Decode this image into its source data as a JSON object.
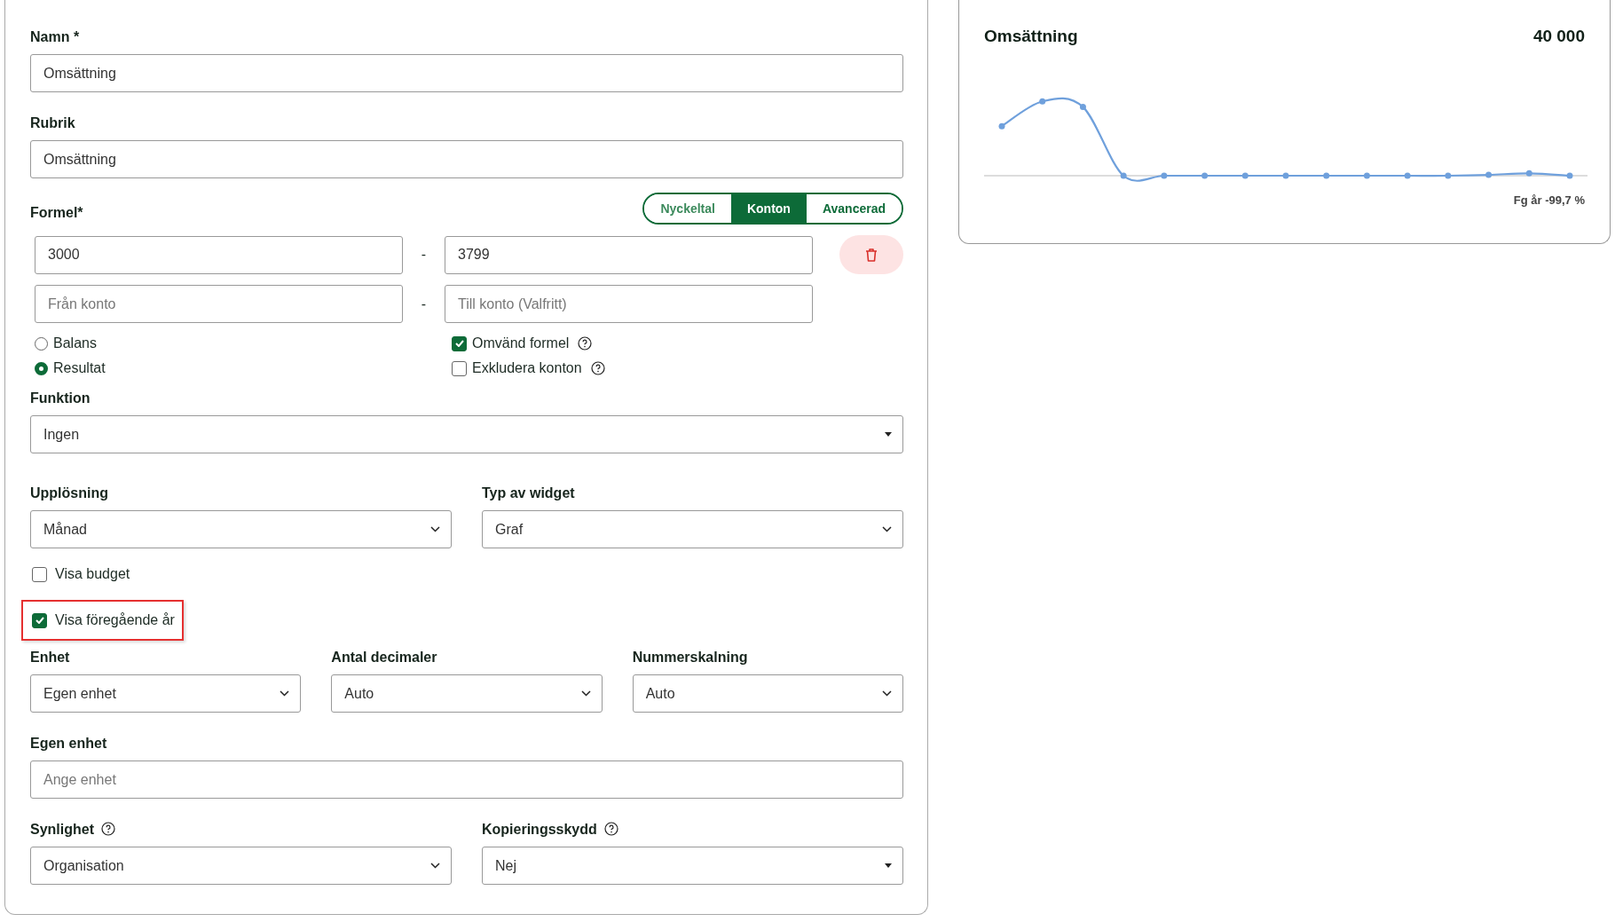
{
  "form": {
    "name": {
      "label": "Namn *",
      "value": "Omsättning"
    },
    "heading": {
      "label": "Rubrik",
      "value": "Omsättning"
    },
    "formula": {
      "label": "Formel*",
      "modes": [
        {
          "label": "Nyckeltal",
          "selected": false
        },
        {
          "label": "Konton",
          "selected": true
        },
        {
          "label": "Avancerad",
          "selected": false
        }
      ],
      "ranges": [
        {
          "from": {
            "value": "3000"
          },
          "separator": "-",
          "to": {
            "value": "3799"
          },
          "deletable": true
        },
        {
          "from": {
            "placeholder": "Från konto"
          },
          "separator": "-",
          "to": {
            "placeholder": "Till konto (Valfritt)"
          },
          "deletable": false
        }
      ],
      "account_types": [
        {
          "label": "Balans",
          "selected": false
        },
        {
          "label": "Resultat",
          "selected": true
        }
      ],
      "options": [
        {
          "label": "Omvänd formel",
          "checked": true,
          "help": true
        },
        {
          "label": "Exkludera konton",
          "checked": false,
          "help": true
        }
      ]
    },
    "function": {
      "label": "Funktion",
      "value": "Ingen",
      "kind": "triangle"
    },
    "row1": [
      {
        "label": "Upplösning",
        "value": "Månad",
        "kind": "chevron"
      },
      {
        "label": "Typ av widget",
        "value": "Graf",
        "kind": "chevron"
      }
    ],
    "toggles": [
      {
        "label": "Visa budget",
        "checked": false,
        "highlighted": false
      },
      {
        "label": "Visa föregående år",
        "checked": true,
        "highlighted": true
      }
    ],
    "row2": [
      {
        "label": "Enhet",
        "value": "Egen enhet",
        "kind": "chevron"
      },
      {
        "label": "Antal decimaler",
        "value": "Auto",
        "kind": "chevron"
      },
      {
        "label": "Nummerskalning",
        "value": "Auto",
        "kind": "chevron"
      }
    ],
    "custom_unit": {
      "label": "Egen enhet",
      "placeholder": "Ange enhet"
    },
    "row3": [
      {
        "label": "Synlighet",
        "help": true,
        "value": "Organisation",
        "kind": "chevron"
      },
      {
        "label": "Kopieringsskydd",
        "help": true,
        "value": "Nej",
        "kind": "triangle"
      }
    ]
  },
  "preview": {
    "title": "Omsättning",
    "value": "40 000",
    "comparison": "Fg år -99,7 %"
  }
}
